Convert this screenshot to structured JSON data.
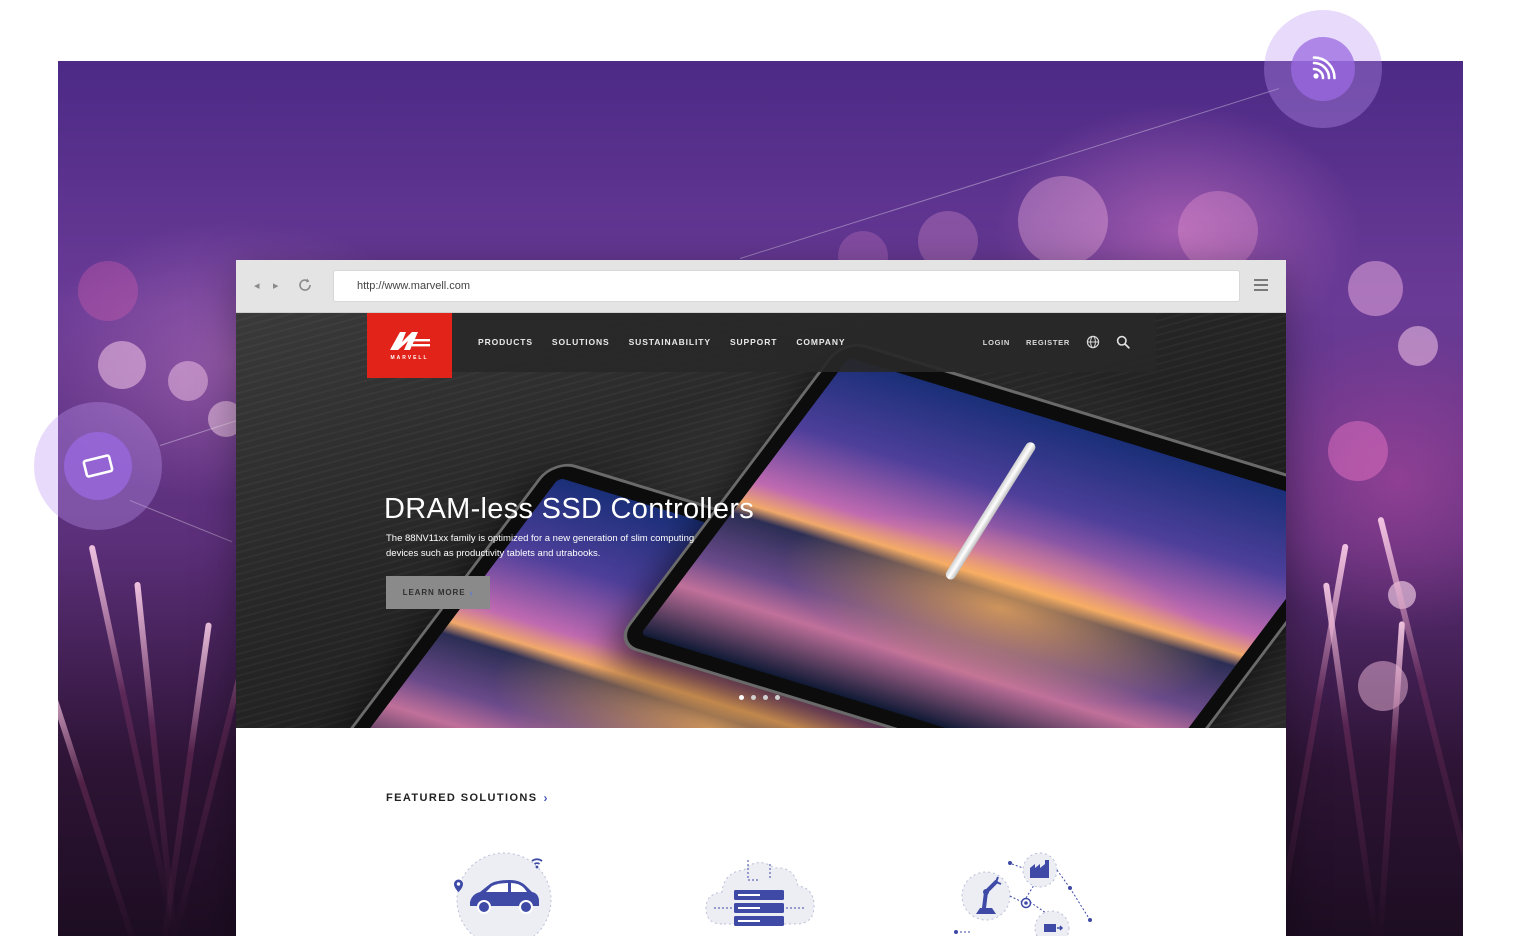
{
  "browser": {
    "url": "http://www.marvell.com",
    "back_icon": "back-arrow-icon",
    "forward_icon": "forward-arrow-icon",
    "reload_icon": "reload-icon",
    "menu_icon": "hamburger-menu-icon"
  },
  "site": {
    "logo_text": "MARVELL",
    "nav": [
      "PRODUCTS",
      "SOLUTIONS",
      "SUSTAINABILITY",
      "SUPPORT",
      "COMPANY"
    ],
    "login": "LOGIN",
    "register": "REGISTER",
    "globe_icon": "globe-icon",
    "search_icon": "search-icon",
    "brand_color": "#e2231a"
  },
  "hero": {
    "title": "DRAM-less SSD Controllers",
    "subtitle": "The 88NV11xx family is optimized for a new generation of slim computing devices such as productivity tablets and utrabooks.",
    "cta": "LEARN MORE",
    "cta_arrow": "›",
    "slides_count": 4,
    "active_slide": 1
  },
  "featured": {
    "title": "FEATURED SOLUTIONS",
    "arrow": "›",
    "items": [
      {
        "icon": "connected-car-icon"
      },
      {
        "icon": "cloud-server-icon"
      },
      {
        "icon": "industrial-iot-icon"
      }
    ],
    "accent_color": "#3e4aa6"
  },
  "decor": {
    "bubbles": [
      "wifi-icon",
      "tablet-icon"
    ],
    "bubble_color": "#9b69e1"
  }
}
